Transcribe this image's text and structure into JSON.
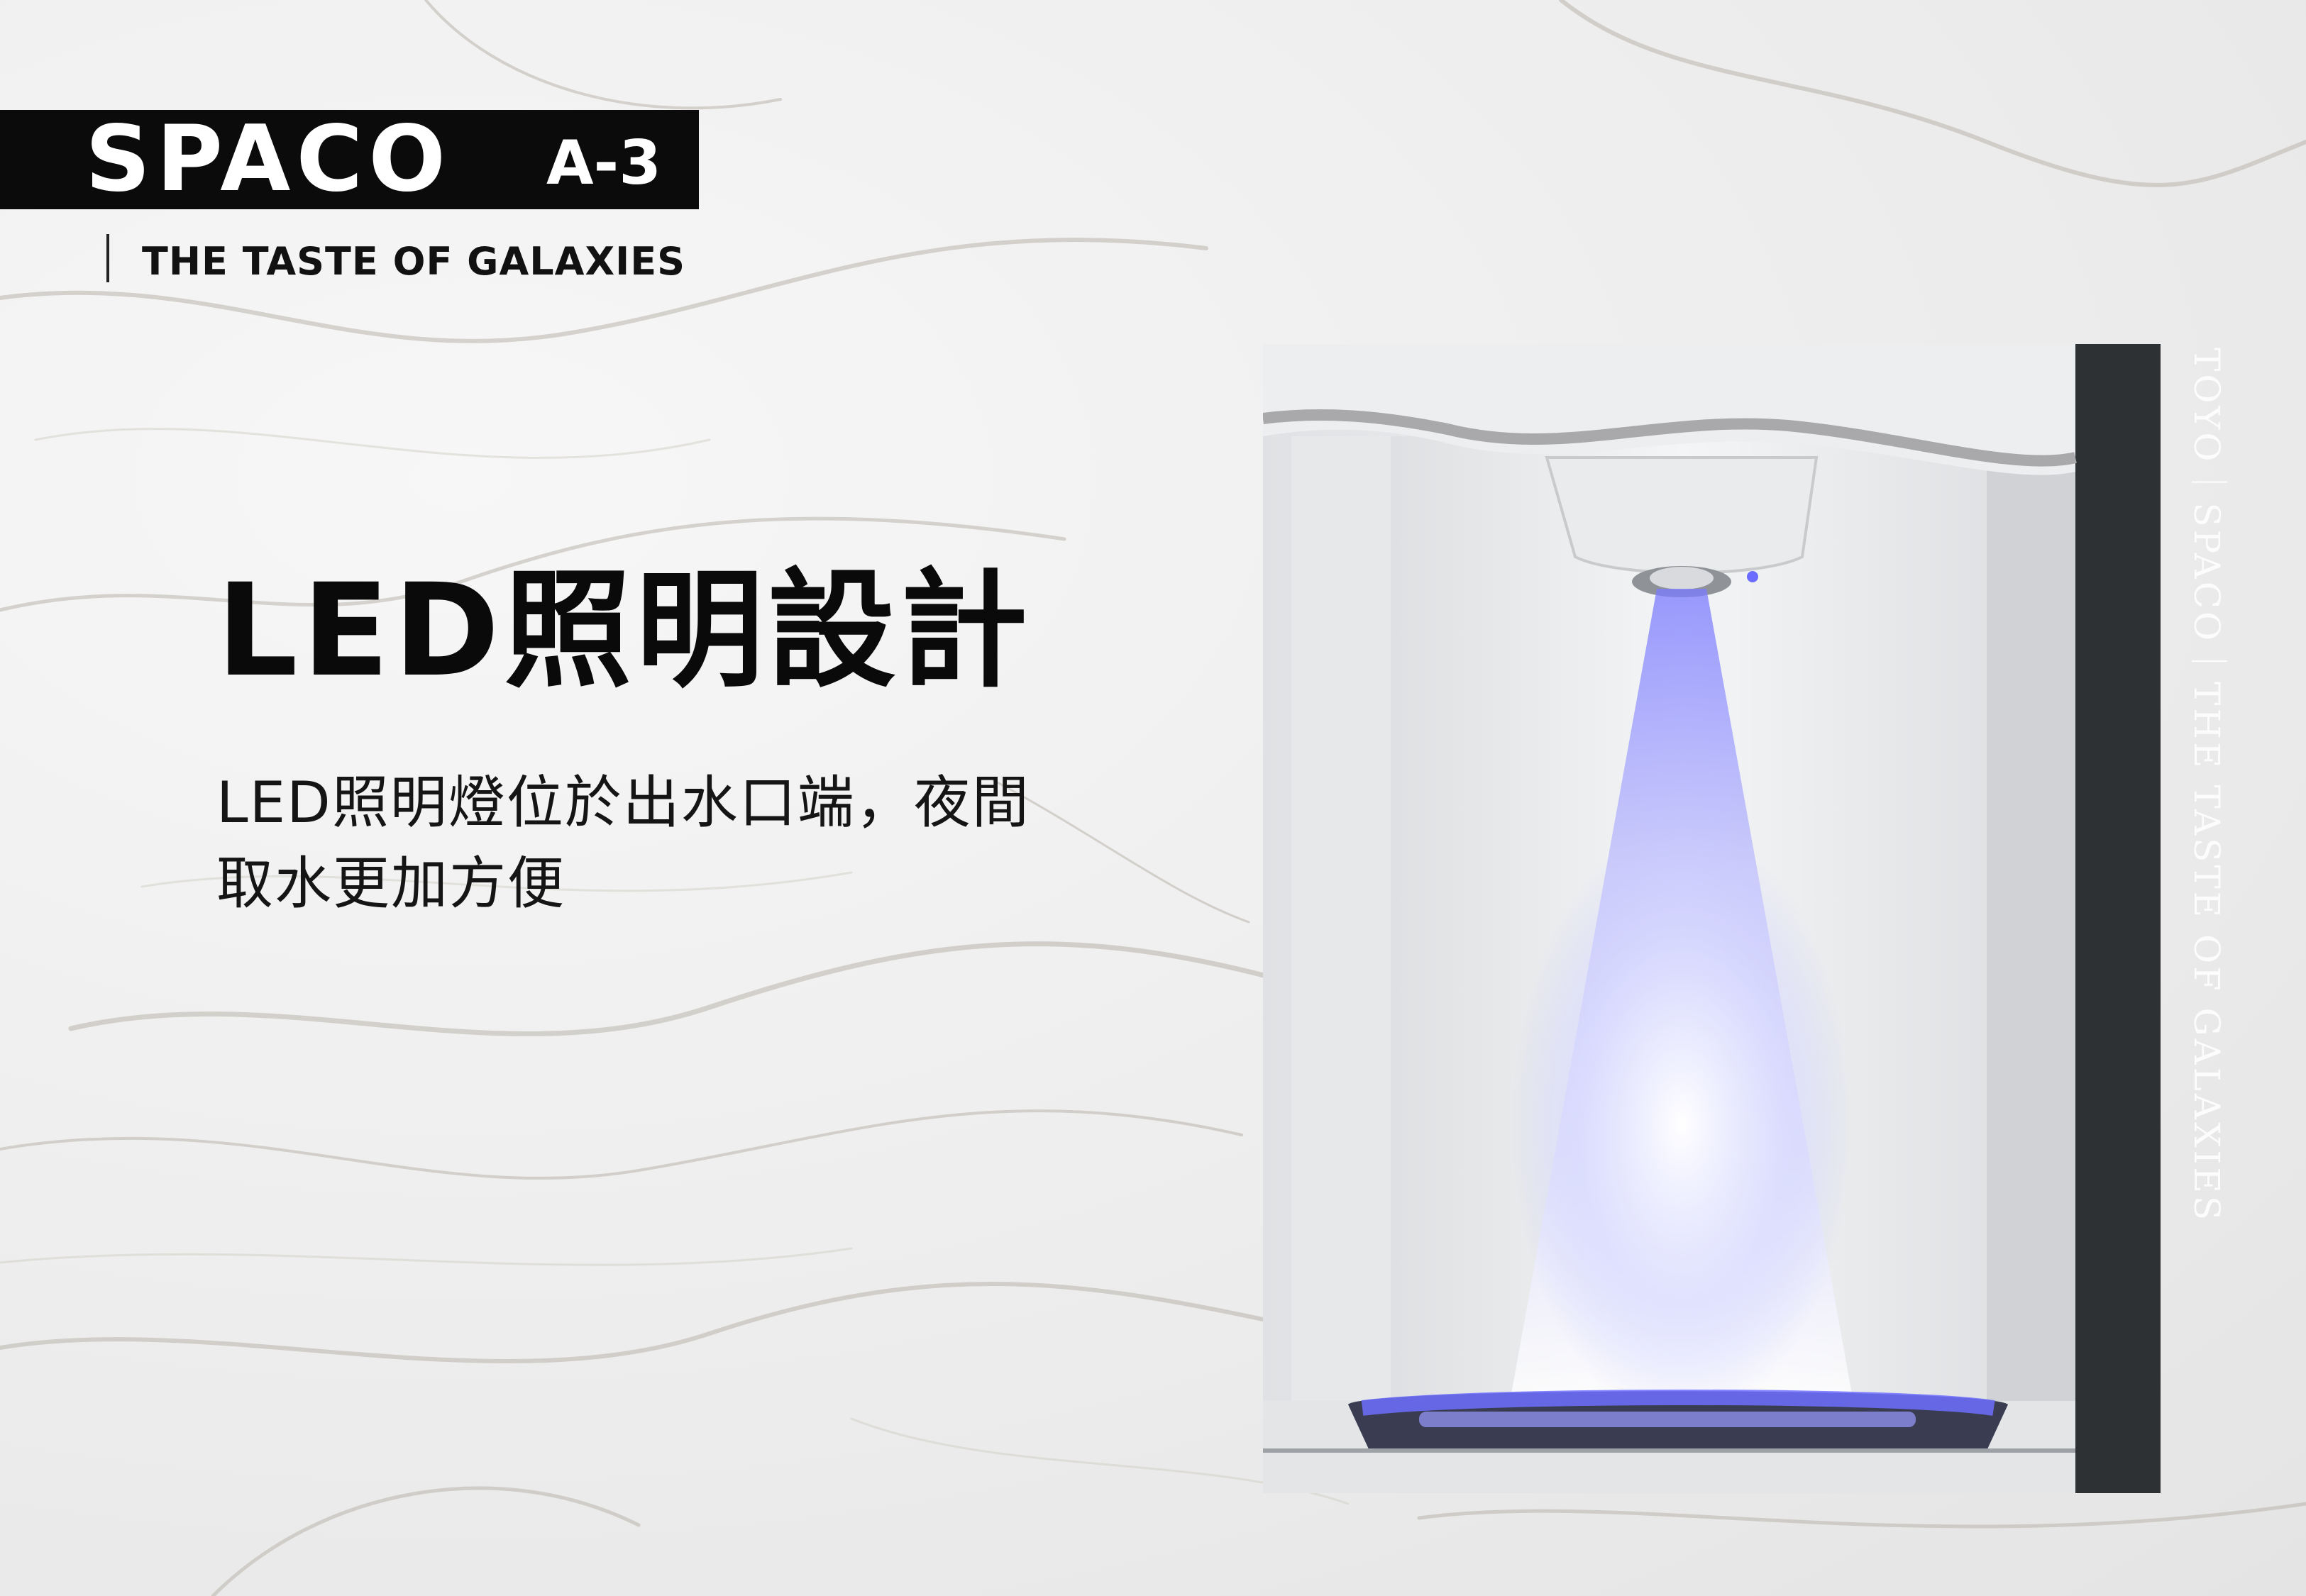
{
  "brand": {
    "logo": "SPACO",
    "model": "A-3",
    "tagline": "THE TASTE OF GALAXIES"
  },
  "feature": {
    "heading": "LED照明設計",
    "description_line1": "LED照明燈位於出水口端，夜間",
    "description_line2": "取水更加方便"
  },
  "side_caption": "TOYO｜SPACO｜THE TASTE OF GALAXIES",
  "colors": {
    "brand_bar": "#0b0b0b",
    "led_glow": "#7b7bff",
    "dark_side_panel": "#2e3133"
  },
  "icons": {
    "product_image": "water-dispenser-led-outlet"
  }
}
